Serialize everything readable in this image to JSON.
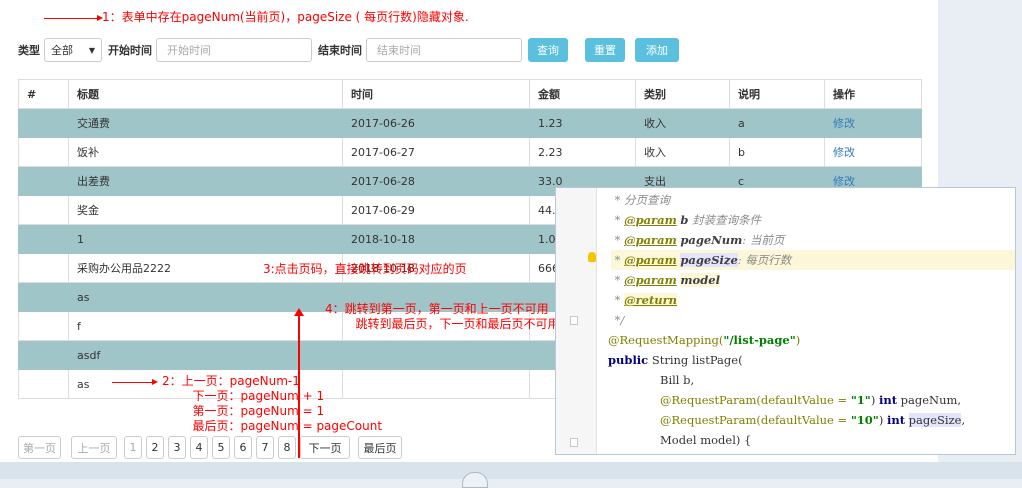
{
  "annotations": {
    "a1": "1：表单中存在pageNum(当前页)，pageSize ( 每页行数)隐藏对象.",
    "a2": "2：上一页：pageNum-1\n        下一页：pageNum + 1\n        第一页：pageNum = 1\n        最后页：pageNum = pageCount",
    "a3": "3:点击页码，直接跳转到页码对应的页",
    "a4": "4：跳转到第一页，第一页和上一页不可用\n        跳转到最后页，下一页和最后页不可用"
  },
  "filter": {
    "type_label": "类型",
    "type_value": "全部",
    "start_label": "开始时间",
    "start_placeholder": "开始时间",
    "end_label": "结束时间",
    "end_placeholder": "结束时间",
    "query_button": "查询",
    "reset_button": "重置",
    "add_button": "添加"
  },
  "table": {
    "headers": [
      "#",
      "标题",
      "时间",
      "金额",
      "类别",
      "说明",
      "操作"
    ],
    "rows": [
      {
        "title": "交通费",
        "time": "2017-06-26",
        "amount": "1.23",
        "category": "收入",
        "desc": "a",
        "op": "修改"
      },
      {
        "title": "饭补",
        "time": "2017-06-27",
        "amount": "2.23",
        "category": "收入",
        "desc": "b",
        "op": "修改"
      },
      {
        "title": "出差费",
        "time": "2017-06-28",
        "amount": "33.0",
        "category": "支出",
        "desc": "c",
        "op": "修改"
      },
      {
        "title": "奖金",
        "time": "2017-06-29",
        "amount": "44.0",
        "category": "",
        "desc": "",
        "op": ""
      },
      {
        "title": "1",
        "time": "2018-10-18",
        "amount": "1.0",
        "category": "",
        "desc": "",
        "op": ""
      },
      {
        "title": "采购办公用品2222",
        "time": "2018-10-18",
        "amount": "666",
        "category": "",
        "desc": "",
        "op": ""
      },
      {
        "title": "as",
        "time": "",
        "amount": "",
        "category": "",
        "desc": "",
        "op": ""
      },
      {
        "title": "f",
        "time": "",
        "amount": "",
        "category": "",
        "desc": "",
        "op": ""
      },
      {
        "title": "asdf",
        "time": "",
        "amount": "",
        "category": "",
        "desc": "",
        "op": ""
      },
      {
        "title": "as",
        "time": "",
        "amount": "",
        "category": "",
        "desc": "",
        "op": ""
      }
    ]
  },
  "pager": {
    "first": "第一页",
    "prev": "上一页",
    "pages": [
      "1",
      "2",
      "3",
      "4",
      "5",
      "6",
      "7",
      "8"
    ],
    "next": "下一页",
    "last": "最后页"
  },
  "code": {
    "l1": " * 分页查询",
    "l2_tag": "@param",
    "l2_name": "b",
    "l2_text": " 封装查询条件",
    "l3_tag": "@param",
    "l3_name": "pageNum",
    "l3_text": ": 当前页",
    "l4_tag": "@param",
    "l4_name": "pageSize",
    "l4_text": ": 每页行数",
    "l5_tag": "@param",
    "l5_name": "model",
    "l6_tag": "@return",
    "l7": " */",
    "l8_ann": "@RequestMapping(",
    "l8_str": "\"/list-page\"",
    "l8_end": ")",
    "l9_kw": "public",
    "l9_text": " String listPage(",
    "l10": "Bill b,",
    "l11_ann": "@RequestParam(defaultValue = ",
    "l11_str": "\"1\"",
    "l11_kw": "int",
    "l11_name": " pageNum,",
    "l12_ann": "@RequestParam(defaultValue = ",
    "l12_str": "\"10\"",
    "l12_kw": "int",
    "l12_name": "pageSize",
    "l12_end": ",",
    "l13": "Model model) {"
  }
}
